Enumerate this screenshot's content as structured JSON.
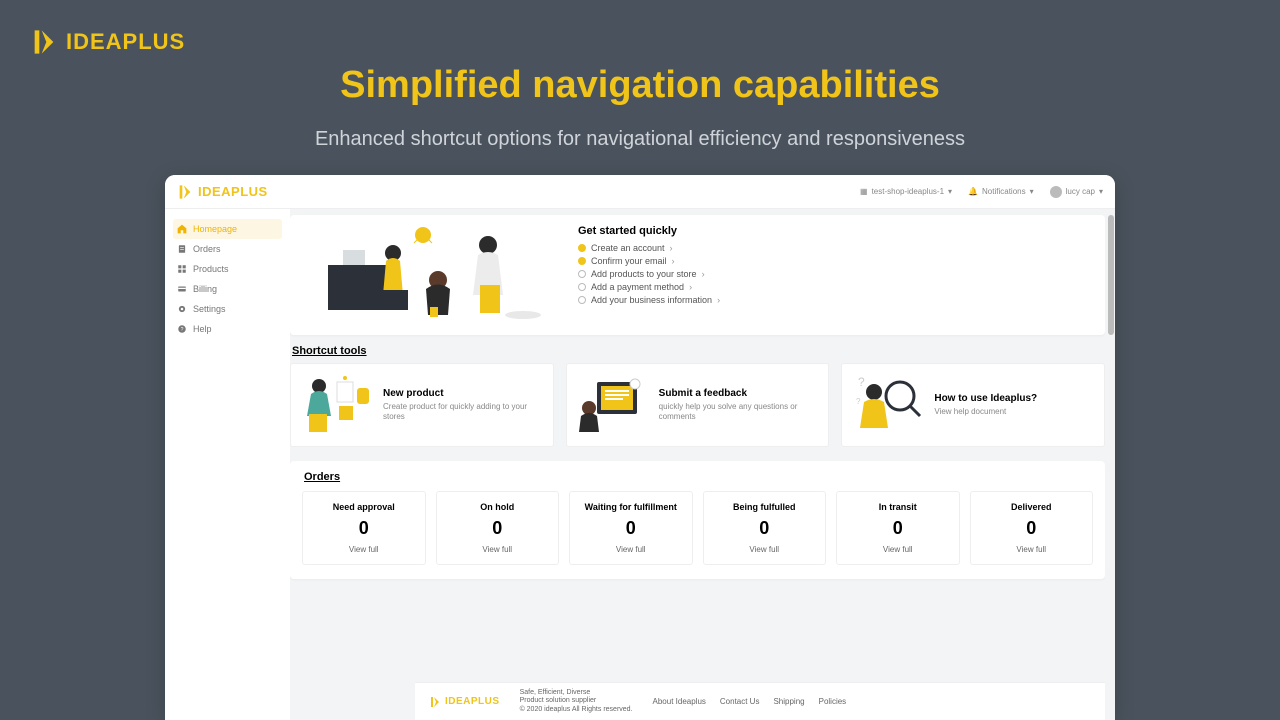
{
  "hero": {
    "brand": "IDEAPLUS",
    "title": "Simplified navigation capabilities",
    "subtitle": "Enhanced shortcut options for navigational efficiency and responsiveness"
  },
  "header": {
    "brand": "IDEAPLUS",
    "shop": "test-shop-ideaplus-1",
    "notifications": "Notifications",
    "user": "lucy cap"
  },
  "sidebar": {
    "items": [
      {
        "label": "Homepage"
      },
      {
        "label": "Orders"
      },
      {
        "label": "Products"
      },
      {
        "label": "Billing"
      },
      {
        "label": "Settings"
      },
      {
        "label": "Help"
      }
    ]
  },
  "getstarted": {
    "title": "Get started quickly",
    "steps": [
      {
        "label": "Create an account",
        "done": true
      },
      {
        "label": "Confirm your email",
        "done": true
      },
      {
        "label": "Add products to your store",
        "done": false
      },
      {
        "label": "Add a payment method",
        "done": false
      },
      {
        "label": "Add your business information",
        "done": false
      }
    ]
  },
  "shortcuts": {
    "title": "Shortcut tools",
    "cards": [
      {
        "title": "New product",
        "desc": "Create product for quickly adding to your stores"
      },
      {
        "title": "Submit a feedback",
        "desc": "quickly help you solve any questions or comments"
      },
      {
        "title": "How to use Ideaplus?",
        "desc": "View help document"
      }
    ]
  },
  "orders": {
    "title": "Orders",
    "boxes": [
      {
        "label": "Need approval",
        "value": "0",
        "link": "View full"
      },
      {
        "label": "On hold",
        "value": "0",
        "link": "View full"
      },
      {
        "label": "Waiting for fulfillment",
        "value": "0",
        "link": "View full"
      },
      {
        "label": "Being fulfulled",
        "value": "0",
        "link": "View full"
      },
      {
        "label": "In transit",
        "value": "0",
        "link": "View full"
      },
      {
        "label": "Delivered",
        "value": "0",
        "link": "View full"
      }
    ]
  },
  "footer": {
    "brand": "IDEAPLUS",
    "tag1": "Safe,  Efficient,  Diverse",
    "tag2": "Product solution supplier",
    "tag3": "© 2020 ideaplus All Rights reserved.",
    "links": [
      "About Ideaplus",
      "Contact Us",
      "Shipping",
      "Policies"
    ]
  }
}
